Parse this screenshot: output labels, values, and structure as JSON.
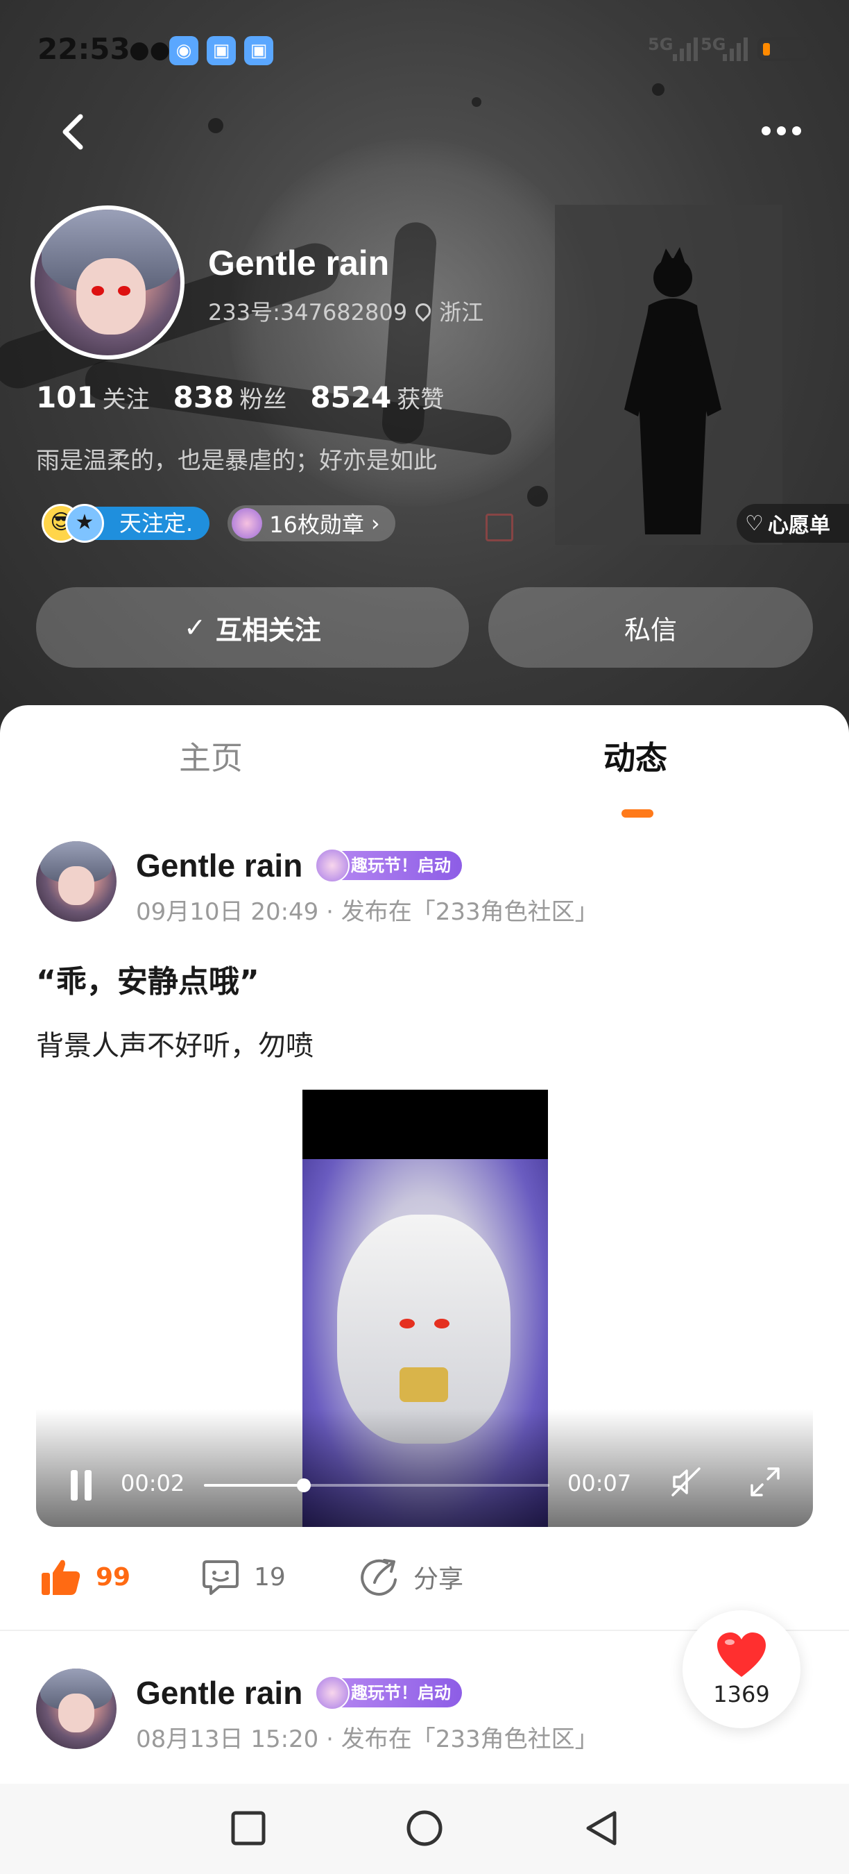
{
  "status_bar": {
    "time": "22:53",
    "signal_1": "5G",
    "signal_2": "5G",
    "battery_color": "#ff8a00"
  },
  "nav": {
    "back_icon": "chevron-left-icon",
    "more_icon": "more-dots-icon"
  },
  "profile": {
    "username": "Gentle rain",
    "id_text": "233号:347682809",
    "location": "浙江",
    "stats": [
      {
        "value": "101",
        "label": "关注"
      },
      {
        "value": "838",
        "label": "粉丝"
      },
      {
        "value": "8524",
        "label": "获赞"
      }
    ],
    "bio": "雨是温柔的，也是暴虐的；好亦是如此",
    "title_badge": "天注定.",
    "medal_badge": "16枚勋章",
    "wish_label": "心愿单",
    "follow_label": "互相关注",
    "message_label": "私信"
  },
  "tabs": {
    "home": "主页",
    "feed": "动态"
  },
  "posts": [
    {
      "author": "Gentle rain",
      "event_badge": "趣玩节！启动",
      "meta": "09月10日 20:49 · 发布在「233角色社区」",
      "title": "“乖，安静点哦”",
      "text": "背景人声不好听，勿喷",
      "video": {
        "current_time": "00:02",
        "total_time": "00:07",
        "progress": 0.29
      },
      "likes": "99",
      "comments": "19",
      "share_label": "分享"
    },
    {
      "author": "Gentle rain",
      "event_badge": "趣玩节！启动",
      "meta": "08月13日 15:20 · 发布在「233角色社区」"
    }
  ],
  "floating_like": {
    "count": "1369",
    "color": "#ff2f2f"
  },
  "accent_color": "#ff7a1a"
}
